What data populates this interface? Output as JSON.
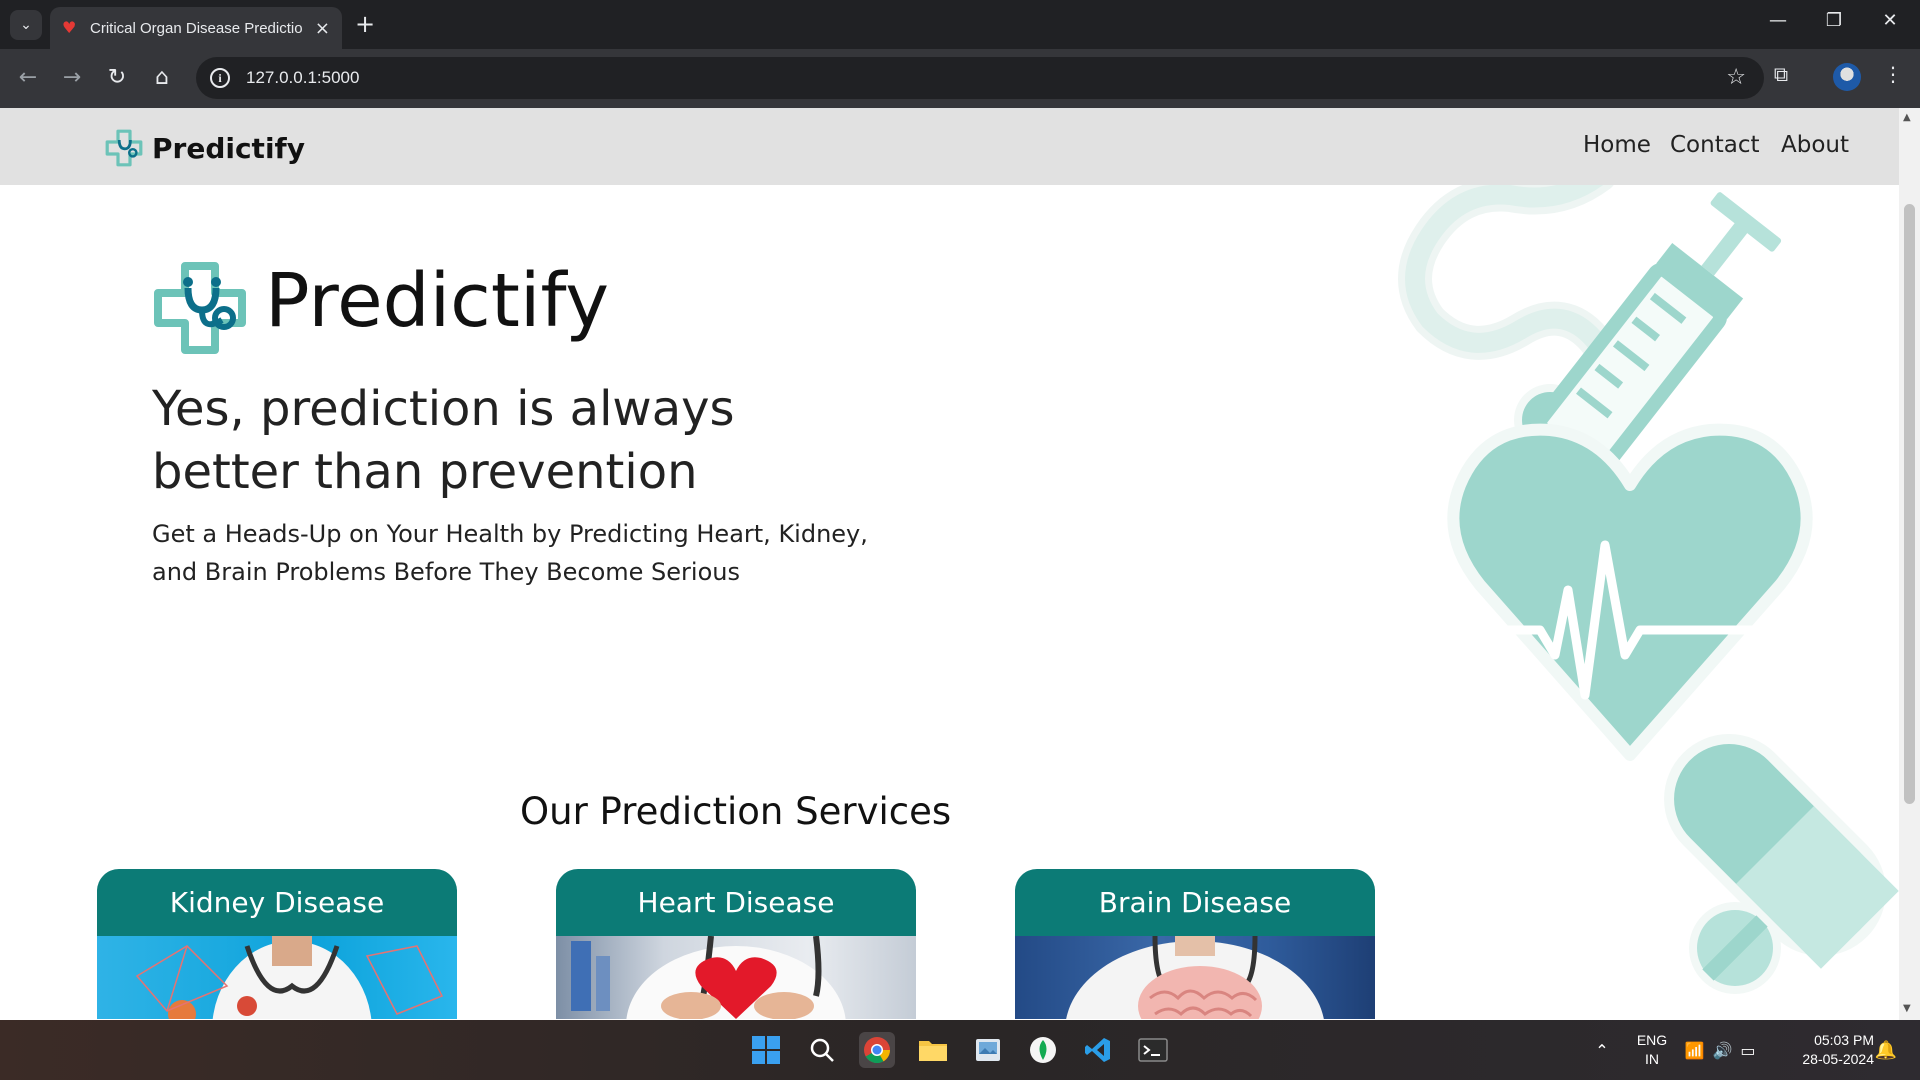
{
  "browser": {
    "tab_title": "Critical Organ Disease Predictio",
    "url": "127.0.0.1:5000"
  },
  "site": {
    "brand": "Predictify",
    "nav": [
      "Home",
      "Contact",
      "About"
    ]
  },
  "hero": {
    "brand": "Predictify",
    "heading": "Yes, prediction is always better than prevention",
    "subheading": "Get a Heads-Up on Your Health by Predicting Heart, Kidney, and Brain Problems Before They Become Serious"
  },
  "services": {
    "title": "Our Prediction Services",
    "cards": [
      {
        "label": "Kidney Disease"
      },
      {
        "label": "Heart Disease"
      },
      {
        "label": "Brain Disease"
      }
    ]
  },
  "taskbar": {
    "lang_line1": "ENG",
    "lang_line2": "IN",
    "time": "05:03 PM",
    "date": "28-05-2024"
  },
  "colors": {
    "accent": "#0c7b76",
    "mint": "#9dd6cc",
    "nav_bg": "#e1e1e1"
  }
}
